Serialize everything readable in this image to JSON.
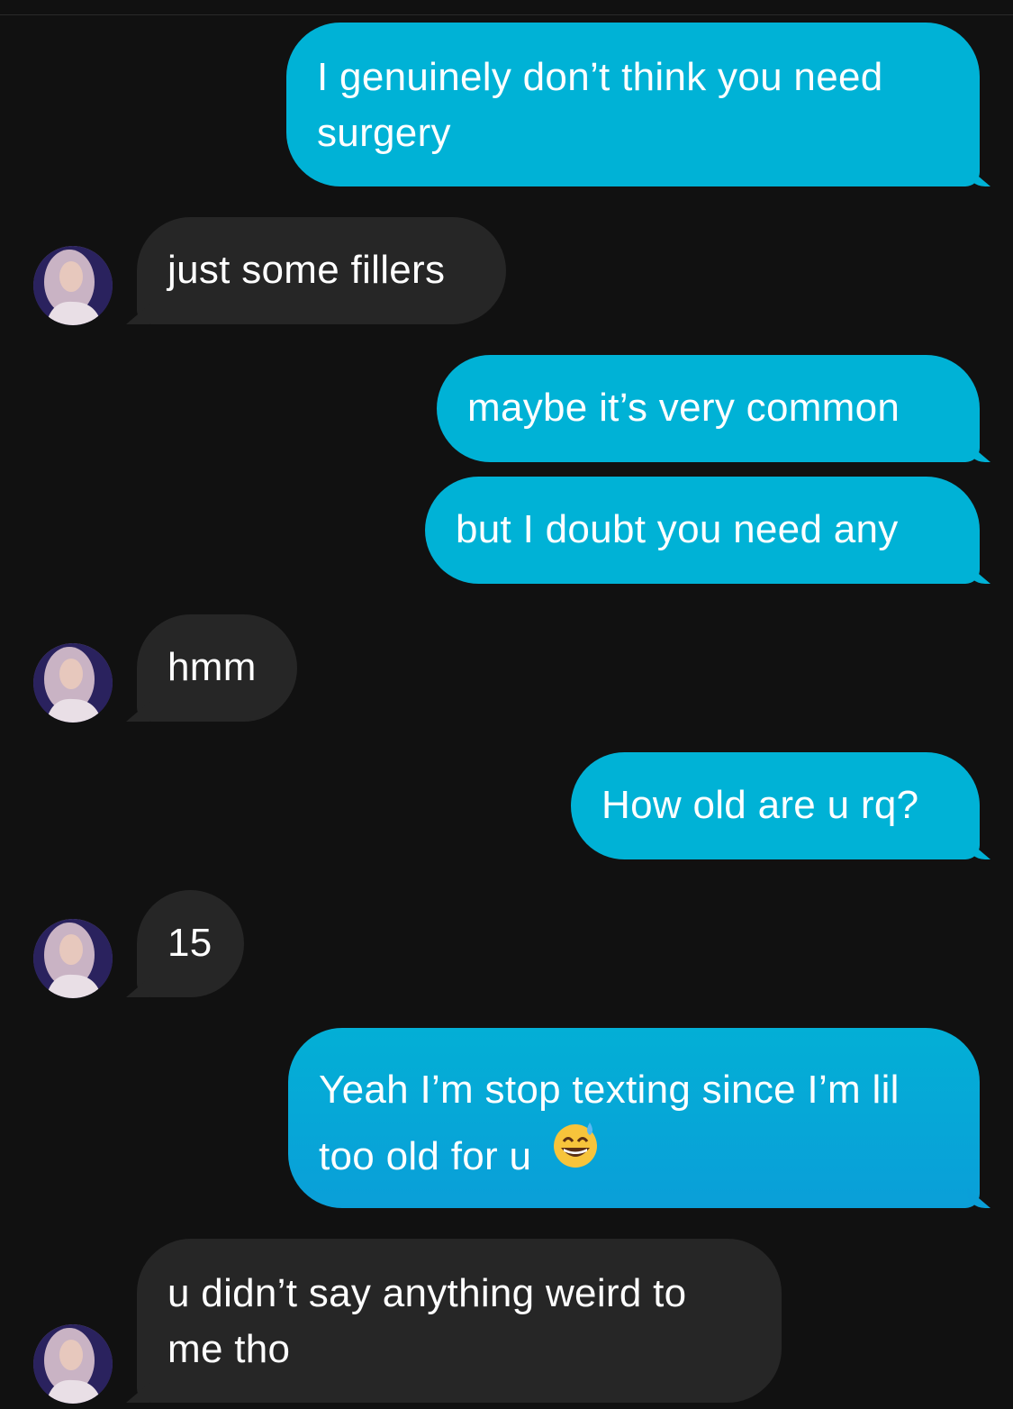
{
  "messages": [
    {
      "id": "m1",
      "direction": "sent",
      "lines": [
        "I genuinely don’t think you need",
        "surgery"
      ]
    },
    {
      "id": "m2",
      "direction": "received",
      "lines": [
        "just some fillers"
      ]
    },
    {
      "id": "m3",
      "direction": "sent",
      "lines": [
        "maybe it’s very common"
      ]
    },
    {
      "id": "m4",
      "direction": "sent",
      "lines": [
        "but I doubt you need any"
      ]
    },
    {
      "id": "m5",
      "direction": "received",
      "lines": [
        "hmm"
      ]
    },
    {
      "id": "m6",
      "direction": "sent",
      "lines": [
        "How old are u rq?"
      ]
    },
    {
      "id": "m7",
      "direction": "received",
      "lines": [
        "15"
      ]
    },
    {
      "id": "m8",
      "direction": "sent",
      "lines": [
        "Yeah I’m stop texting since I’m lil",
        "too old for u"
      ],
      "emoji": "grinning-sweat-emoji"
    },
    {
      "id": "m9",
      "direction": "received",
      "lines": [
        "u didn’t say anything weird to",
        "me tho"
      ]
    }
  ],
  "colors": {
    "background": "#111111",
    "sent_bubble": "#00b2d6",
    "received_bubble": "#262626",
    "text": "#ffffff"
  }
}
